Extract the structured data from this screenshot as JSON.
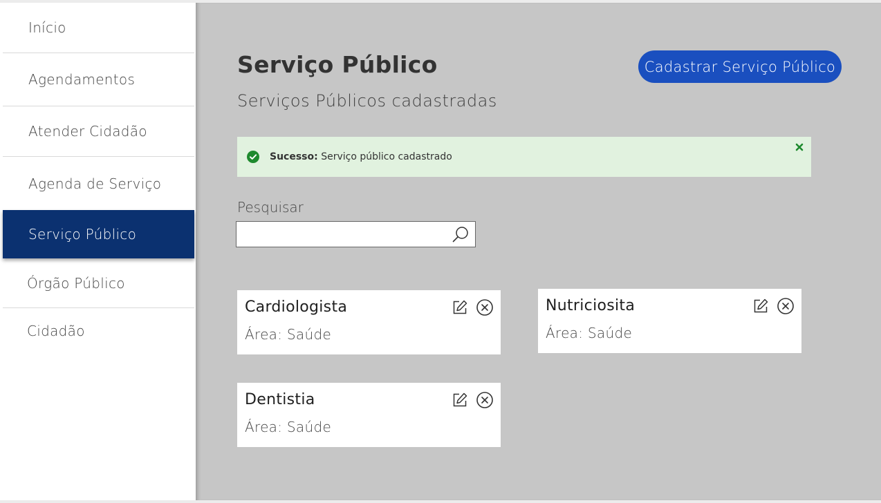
{
  "sidebar": {
    "items": [
      {
        "label": "Início",
        "active": false
      },
      {
        "label": "Agendamentos",
        "active": false
      },
      {
        "label": "Atender Cidadão",
        "active": false
      },
      {
        "label": "Agenda de Serviço",
        "active": false
      },
      {
        "label": "Serviço Público",
        "active": true
      },
      {
        "label": "Órgão Público",
        "active": false
      },
      {
        "label": "Cidadão",
        "active": false
      }
    ]
  },
  "header": {
    "title": "Serviço Público",
    "subtitle": "Serviços Públicos cadastradas",
    "add_button_label": "Cadastrar Serviço Público"
  },
  "alert": {
    "strong": "Sucesso:",
    "message": "Serviço público cadastrado",
    "icon": "check-circle-icon",
    "close_icon": "close-icon"
  },
  "search": {
    "label": "Pesquisar",
    "value": "",
    "placeholder": "",
    "icon": "search-icon"
  },
  "cards": [
    {
      "title": "Cardiologista",
      "area": "Área: Saúde"
    },
    {
      "title": "Nutriciosita",
      "area": "Área: Saúde"
    },
    {
      "title": "Dentistia",
      "area": "Área: Saúde"
    }
  ],
  "colors": {
    "sidebar_active": "#0b3170",
    "button_primary": "#1a4fbf",
    "main_background": "#c6c6c6",
    "alert_background": "#e1f2df",
    "alert_success": "#1e8a2e"
  }
}
